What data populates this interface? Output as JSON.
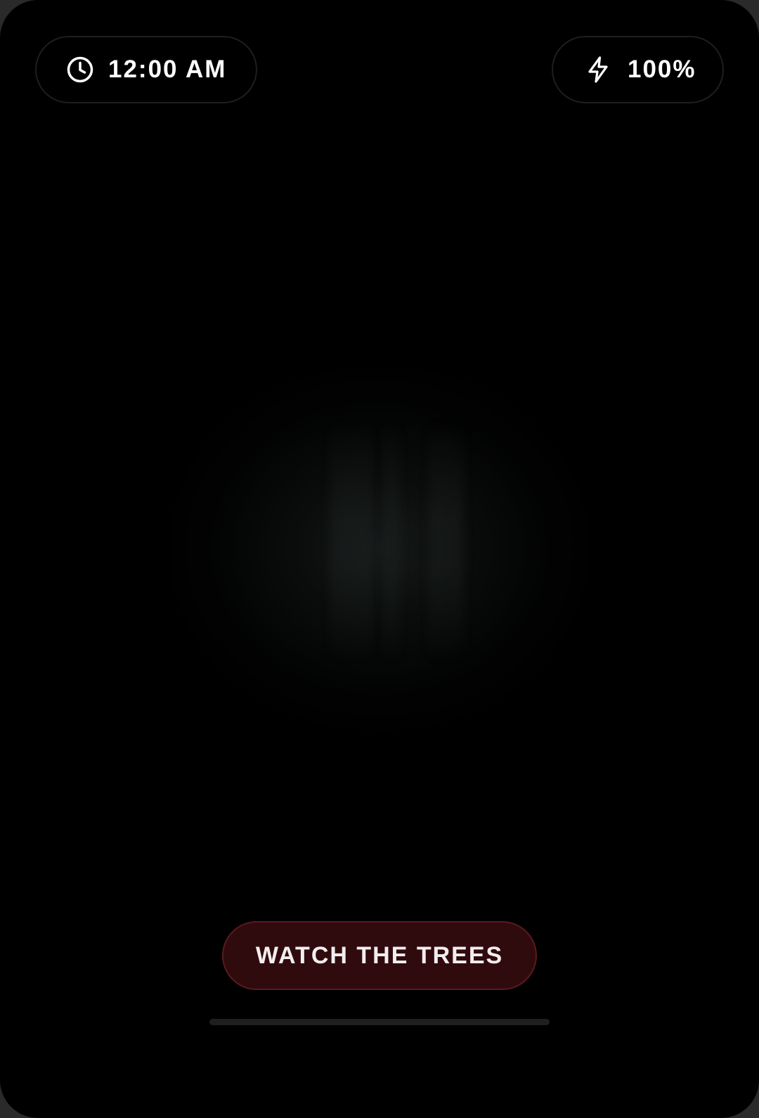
{
  "status": {
    "time": "12:00 AM",
    "battery": "100%",
    "time_icon": "clock-icon",
    "battery_icon": "lightning-bolt-icon"
  },
  "action": {
    "label": "WATCH THE TREES"
  },
  "colors": {
    "background": "#000000",
    "pill_border": "#1e1e1e",
    "button_fill": "#300b0e",
    "button_border": "#5a1a1f",
    "text": "#ffffff"
  }
}
